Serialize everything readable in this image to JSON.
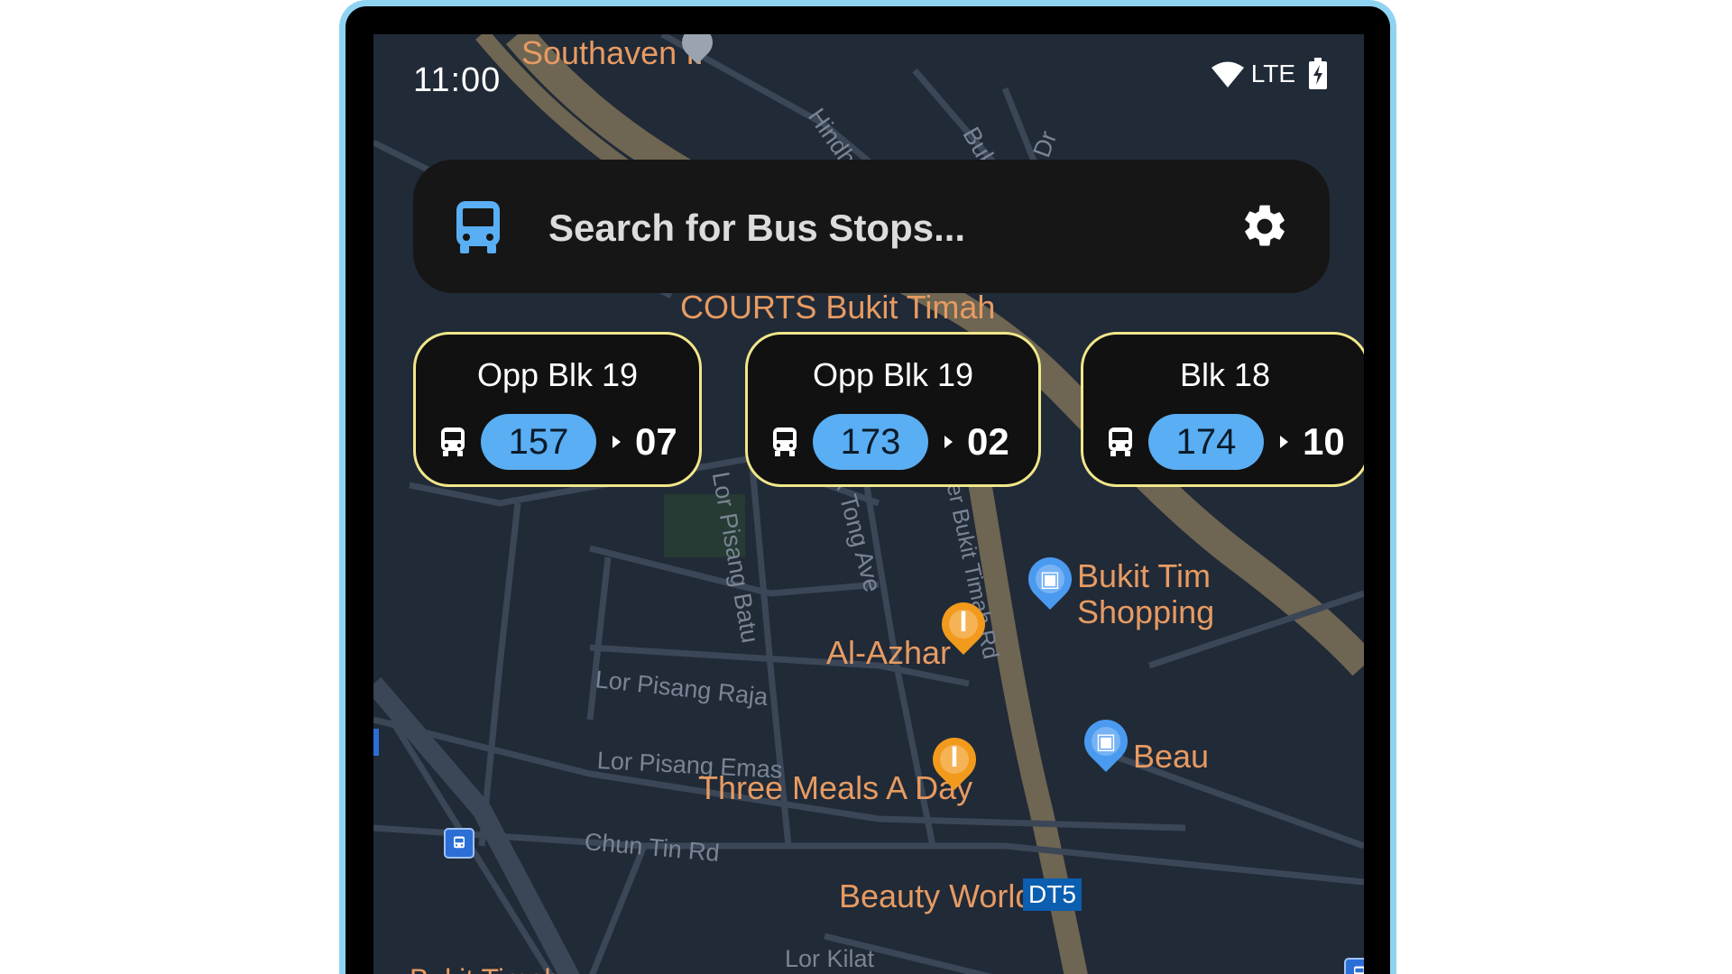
{
  "status_bar": {
    "time": "11:00",
    "network": "LTE"
  },
  "search": {
    "placeholder": "Search for Bus Stops...",
    "icon": "bus-icon",
    "settings_icon": "gear-icon"
  },
  "colors": {
    "accent": "#5aaef3",
    "card_border": "#f1e78a",
    "map_bg": "#212a37",
    "poi": "#e79b62"
  },
  "bus_stops": [
    {
      "name": "Opp Blk 19",
      "service": "157",
      "eta": "07"
    },
    {
      "name": "Opp Blk 19",
      "service": "173",
      "eta": "02"
    },
    {
      "name": "Blk 18",
      "service": "174",
      "eta": "10"
    }
  ],
  "map": {
    "road_labels": {
      "hindhede": "Hindhede V",
      "bukit_dr": "Bukit Dr",
      "dr": "Dr",
      "lor_pisang_batu": "Lor Pisang Batu",
      "lk_tong_ave": "lk Tong Ave",
      "upper_bukit_timah": "per Bukit Timah Rd",
      "lor_pisang_raja": "Lor Pisang Raja",
      "lor_pisang_emas": "Lor Pisang Emas",
      "chun_tin_rd": "Chun Tin Rd",
      "lor_kilat": "Lor Kilat",
      "bukit_timah_bottom": "Bukit Timah"
    },
    "places": {
      "southaven": "Southaven II",
      "courts": "COURTS Bukit Timah",
      "al_azhar": "Al-Azhar",
      "three_meals": "Three Meals A Day",
      "beauty_world": "Beauty World",
      "bukit_timah_shopping_1": "Bukit Tim",
      "bukit_timah_shopping_2": "Shopping",
      "beau": "Beau"
    },
    "station_code": "DT5"
  }
}
